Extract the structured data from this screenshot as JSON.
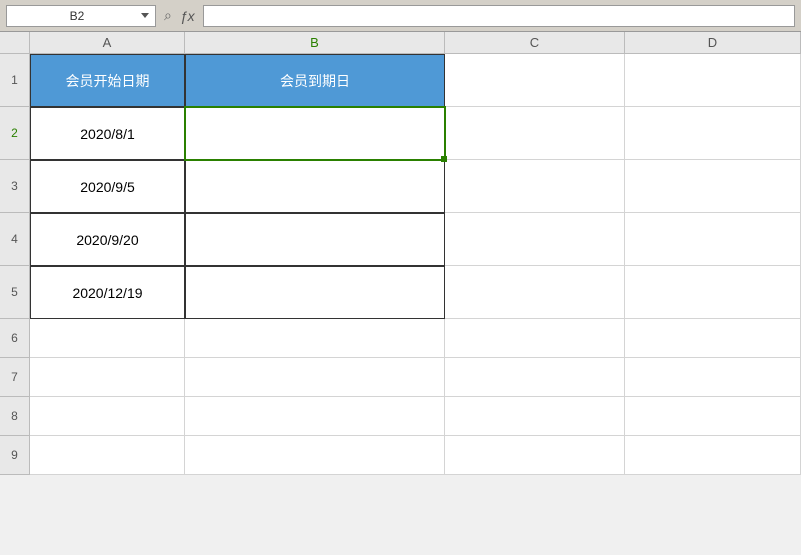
{
  "toolbar": {
    "name_box": "B2",
    "formula_value": ""
  },
  "columns": [
    "A",
    "B",
    "C",
    "D"
  ],
  "active_cell": {
    "col": "B",
    "row": 2
  },
  "headers": {
    "colA": "会员开始日期",
    "colB": "会员到期日"
  },
  "data_rows": [
    {
      "a": "2020/8/1",
      "b": ""
    },
    {
      "a": "2020/9/5",
      "b": ""
    },
    {
      "a": "2020/9/20",
      "b": ""
    },
    {
      "a": "2020/12/19",
      "b": ""
    }
  ],
  "row_numbers": [
    "1",
    "2",
    "3",
    "4",
    "5",
    "6",
    "7",
    "8",
    "9"
  ],
  "colors": {
    "header_bg": "#4f99d6",
    "selection": "#2a8000"
  }
}
